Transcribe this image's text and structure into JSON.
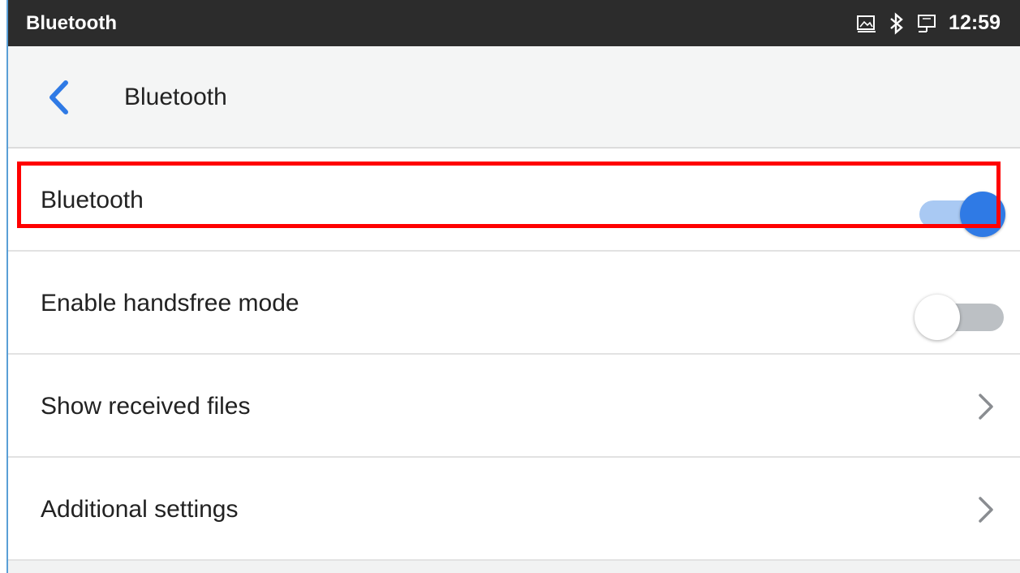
{
  "status_bar": {
    "app_title": "Bluetooth",
    "time": "12:59",
    "icons": [
      "screenshot-icon",
      "bluetooth-icon",
      "monitor-icon"
    ]
  },
  "header": {
    "title": "Bluetooth",
    "back_icon": "chevron-left-icon"
  },
  "settings": {
    "bluetooth": {
      "label": "Bluetooth",
      "enabled": true
    },
    "handsfree": {
      "label": "Enable handsfree mode",
      "enabled": false
    },
    "received_files": {
      "label": "Show received files"
    },
    "additional": {
      "label": "Additional settings"
    }
  },
  "colors": {
    "accent": "#2f7ae5",
    "accent_track": "#a9c9f3",
    "highlight": "#ff0000",
    "status_bar": "#2c2c2c"
  }
}
